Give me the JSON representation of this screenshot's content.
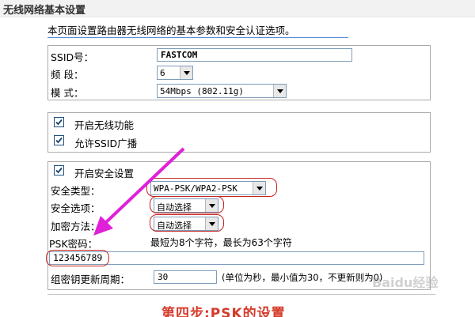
{
  "header": {
    "title": "无线网络基本设置"
  },
  "intro": "本页面设置路由器无线网络的基本参数和安全认证选项。",
  "basic": {
    "ssid_label": "SSID号：",
    "ssid_value": "FASTCOM",
    "channel_label": "频 段：",
    "channel_value": "6",
    "mode_label": "模 式：",
    "mode_value": "54Mbps (802.11g)"
  },
  "wireless": {
    "enable_wireless_label": "开启无线功能",
    "enable_wireless_checked": true,
    "allow_ssid_broadcast_label": "允许SSID广播",
    "allow_ssid_broadcast_checked": true
  },
  "security": {
    "enable_security_label": "开启安全设置",
    "enable_security_checked": true,
    "security_type_label": "安全类型：",
    "security_type_value": "WPA-PSK/WPA2-PSK",
    "security_option_label": "安全选项：",
    "security_option_value": "自动选择",
    "encryption_label": "加密方法：",
    "encryption_value": "自动选择",
    "psk_label": "PSK密码：",
    "psk_hint": "最短为8个字符，最长为63个字符",
    "psk_value": "123456789",
    "rekey_label": "组密钥更新周期：",
    "rekey_value": "30",
    "rekey_hint": "(单位为秒，最小值为30，不更新则为0)"
  },
  "caption": "第四步:PSK的设置",
  "watermark": "Baidu经验",
  "colors": {
    "annotation_red": "#c8231f",
    "arrow_magenta": "#e020d8",
    "caption_red": "#d63a2a"
  }
}
